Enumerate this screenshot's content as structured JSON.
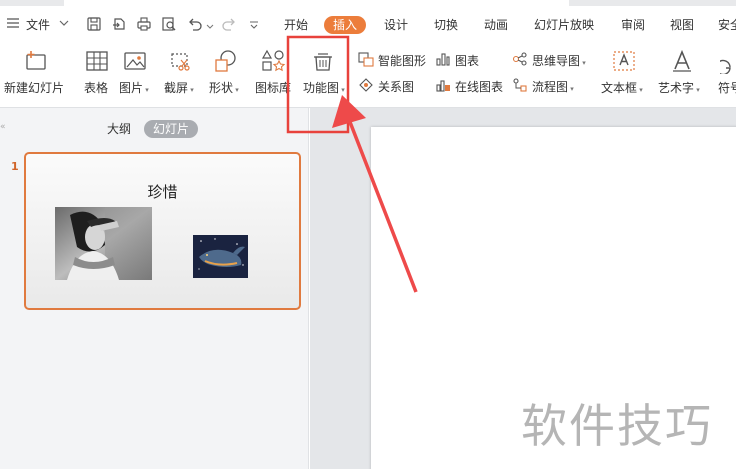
{
  "menubar": {
    "hamburger_icon": "hamburger-icon",
    "file_label": "文件",
    "tabs": [
      {
        "label": "开始",
        "active": false
      },
      {
        "label": "插入",
        "active": true
      },
      {
        "label": "设计",
        "active": false
      },
      {
        "label": "切换",
        "active": false
      },
      {
        "label": "动画",
        "active": false
      },
      {
        "label": "幻灯片放映",
        "active": false
      },
      {
        "label": "审阅",
        "active": false
      },
      {
        "label": "视图",
        "active": false
      },
      {
        "label": "安全",
        "active": false
      }
    ],
    "quick_access_icons": [
      "save-icon",
      "export-icon",
      "print-icon",
      "print-preview-icon",
      "undo-icon",
      "redo-icon",
      "customize-icon"
    ]
  },
  "ribbon": {
    "new_slide": "新建幻灯片",
    "table": "表格",
    "picture": "图片",
    "screenshot": "截屏",
    "shape": "形状",
    "icon_library": "图标库",
    "function_chart": "功能图",
    "smart_shape": "智能图形",
    "chart": "图表",
    "mind_map": "思维导图",
    "relation_chart": "关系图",
    "online_chart": "在线图表",
    "flow_chart": "流程图",
    "text_box": "文本框",
    "word_art": "艺术字",
    "symbol": "符号"
  },
  "left_pane": {
    "collapse_glyph": "«",
    "tabs": [
      {
        "label": "大纲",
        "active": false
      },
      {
        "label": "幻灯片",
        "active": true
      }
    ],
    "slides": [
      {
        "number": "1",
        "title": "珍惜"
      }
    ]
  },
  "canvas": {
    "watermark": "软件技巧"
  },
  "colors": {
    "accent": "#ec7d3b",
    "highlight_box": "#e8423c",
    "arrow": "#ee4a4a",
    "ribbon_icon_orange": "#e07a3f"
  }
}
